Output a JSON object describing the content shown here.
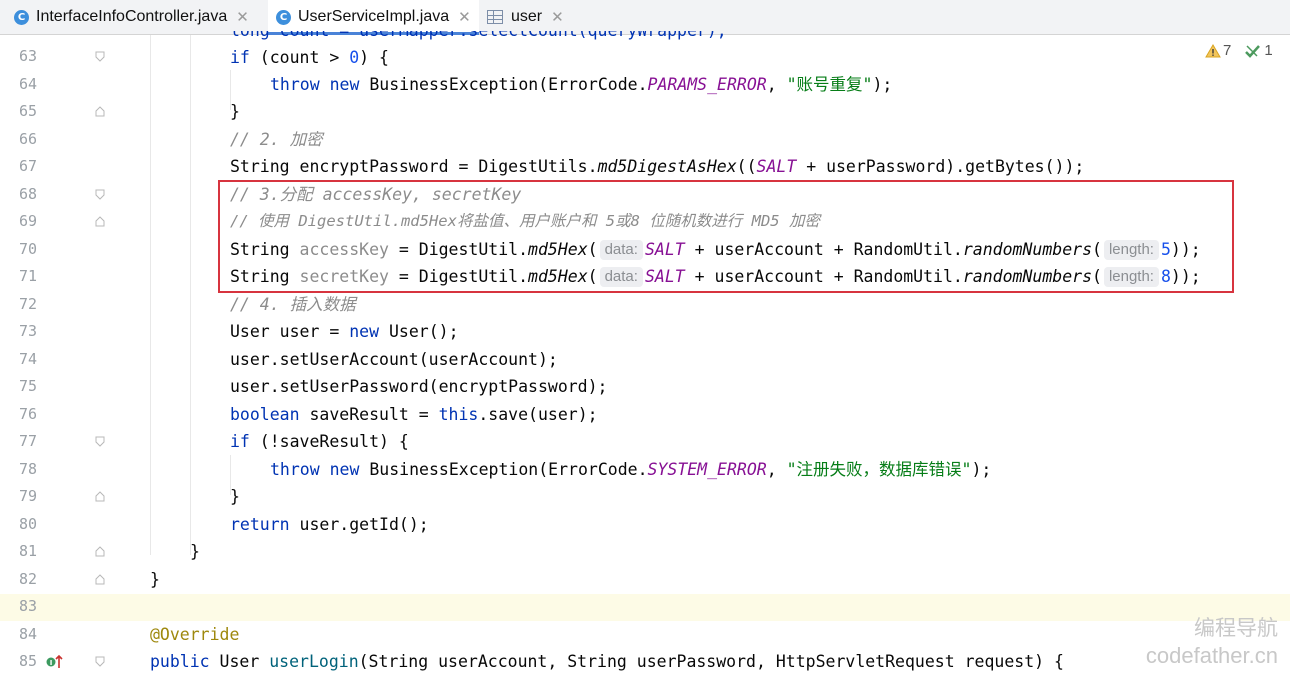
{
  "tabs": [
    {
      "label": "InterfaceInfoController.java",
      "icon": "class-icon"
    },
    {
      "label": "UserServiceImpl.java",
      "icon": "class-icon"
    },
    {
      "label": "user",
      "icon": "table-icon"
    }
  ],
  "inspections": {
    "warnings": "7",
    "weak_warnings": "1"
  },
  "line_numbers": [
    "63",
    "64",
    "65",
    "66",
    "67",
    "68",
    "69",
    "70",
    "71",
    "72",
    "73",
    "74",
    "75",
    "76",
    "77",
    "78",
    "79",
    "80",
    "81",
    "82",
    "83",
    "84",
    "85"
  ],
  "code": {
    "l62_partial": "long count = userMapper.selectCount(queryWrapper);",
    "l63": {
      "a": "if",
      "b": " (count > ",
      "c": "0",
      "d": ") {"
    },
    "l64": {
      "a": "throw",
      "b": " ",
      "c": "new",
      "d": " BusinessException(ErrorCode.",
      "e": "PARAMS_ERROR",
      "f": ", ",
      "g": "\"账号重复\"",
      "h": ");"
    },
    "l65": "}",
    "l66": "// 2. 加密",
    "l67": {
      "a": "String encryptPassword = DigestUtils.",
      "b": "md5DigestAsHex",
      "c": "((",
      "d": "SALT",
      "e": " + userPassword).getBytes());"
    },
    "l68": "// 3.分配 accessKey, secretKey",
    "l69": "// 使用 DigestUtil.md5Hex将盐值、用户账户和 5或8 位随机数进行 MD5 加密",
    "l70": {
      "a": "String ",
      "b": "accessKey",
      "c": " = DigestUtil.",
      "d": "md5Hex",
      "e": "(",
      "hint1": "data:",
      "f": "SALT",
      "g": " + userAccount + RandomUtil.",
      "h": "randomNumbers",
      "i": "(",
      "hint2": "length:",
      "j": "5",
      "k": "));"
    },
    "l71": {
      "a": "String ",
      "b": "secretKey",
      "c": " = DigestUtil.",
      "d": "md5Hex",
      "e": "(",
      "hint1": "data:",
      "f": "SALT",
      "g": " + userAccount + RandomUtil.",
      "h": "randomNumbers",
      "i": "(",
      "hint2": "length:",
      "j": "8",
      "k": "));"
    },
    "l72": "// 4. 插入数据",
    "l73": {
      "a": "User user = ",
      "b": "new",
      "c": " User();"
    },
    "l74": "user.setUserAccount(userAccount);",
    "l75": "user.setUserPassword(encryptPassword);",
    "l76": {
      "a": "boolean",
      "b": " saveResult = ",
      "c": "this",
      "d": ".save(user);"
    },
    "l77": {
      "a": "if",
      "b": " (!saveResult) {"
    },
    "l78": {
      "a": "throw",
      "b": " ",
      "c": "new",
      "d": " BusinessException(ErrorCode.",
      "e": "SYSTEM_ERROR",
      "f": ", ",
      "g": "\"注册失败，数据库错误\"",
      "h": ");"
    },
    "l79": "}",
    "l80": {
      "a": "return",
      "b": " user.getId();"
    },
    "l81": "}",
    "l82": "}",
    "l84": "@Override",
    "l85": {
      "a": "public",
      "b": " User ",
      "c": "userLogin",
      "d": "(String userAccount, String userPassword, HttpServletRequest request) {"
    }
  },
  "watermark": {
    "line1": "编程导航",
    "line2": "codefather.cn"
  }
}
